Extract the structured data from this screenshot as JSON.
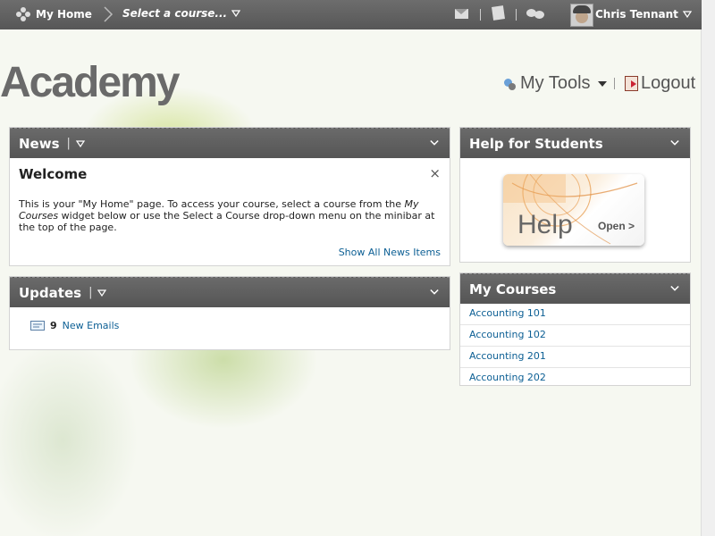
{
  "minibar": {
    "home_label": "My Home",
    "course_select_label": "Select a course...",
    "user_name": "Chris Tennant"
  },
  "header": {
    "logo_text": "Academy",
    "my_tools_label": "My Tools",
    "logout_label": "Logout"
  },
  "news": {
    "title": "News",
    "item_title": "Welcome",
    "body_part1": "This is your \"My Home\" page. To access your course, select a course from the ",
    "body_italic": "My Courses",
    "body_part2": " widget below or use the Select a Course drop-down menu on the minibar at the top of the page.",
    "show_all_label": "Show All News Items",
    "close_symbol": "×"
  },
  "updates": {
    "title": "Updates",
    "email_count": "9",
    "email_label": "New Emails"
  },
  "help": {
    "title": "Help for Students",
    "banner_text": "Help",
    "banner_open": "Open >"
  },
  "my_courses": {
    "title": "My Courses",
    "items": [
      {
        "label": "Accounting 101"
      },
      {
        "label": "Accounting 102"
      },
      {
        "label": "Accounting 201"
      },
      {
        "label": "Accounting 202"
      }
    ]
  }
}
